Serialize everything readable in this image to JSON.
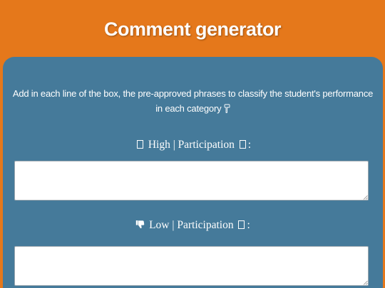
{
  "header": {
    "title": "Comment generator"
  },
  "instructions": {
    "text": "Add in each line of the box, the pre-approved phrases to classify the student's performance in each category",
    "icon": "pointing-down-icon"
  },
  "sections": [
    {
      "icon": "missing-glyph-icon",
      "level": "High",
      "separator": "|",
      "category": "Participation",
      "suffix": ":",
      "textarea_value": ""
    },
    {
      "icon": "thumbs-down-icon",
      "level": "Low",
      "separator": "|",
      "category": "Participation",
      "suffix": ":",
      "textarea_value": ""
    }
  ],
  "colors": {
    "page_background": "#e5781b",
    "card_background": "#457a9a",
    "text": "#ffffff"
  }
}
